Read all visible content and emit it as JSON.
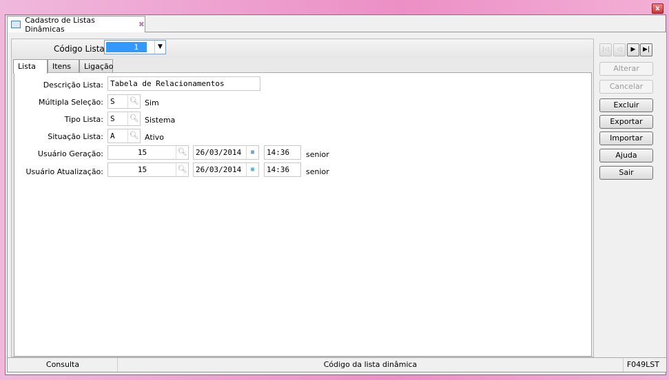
{
  "window": {
    "tab_title": "Cadastro de Listas Dinâmicas"
  },
  "header": {
    "codigo_label": "Código Lista:",
    "codigo_value": "1"
  },
  "tabs": [
    "Lista",
    "Itens",
    "Ligação"
  ],
  "form": {
    "descricao_label": "Descrição Lista:",
    "descricao_value": "Tabela de Relacionamentos",
    "multipla_label": "Múltipla Seleção:",
    "multipla_value": "S",
    "multipla_desc": "Sim",
    "tipo_label": "Tipo Lista:",
    "tipo_value": "S",
    "tipo_desc": "Sistema",
    "situacao_label": "Situação Lista:",
    "situacao_value": "A",
    "situacao_desc": "Ativo",
    "geracao_label": "Usuário Geração:",
    "geracao_user": "15",
    "geracao_date": "26/03/2014",
    "geracao_time": "14:36",
    "geracao_name": "senior",
    "atualizacao_label": "Usuário Atualização:",
    "atualizacao_user": "15",
    "atualizacao_date": "26/03/2014",
    "atualizacao_time": "14:36",
    "atualizacao_name": "senior"
  },
  "buttons": {
    "alterar": "Alterar",
    "cancelar": "Cancelar",
    "excluir": "Excluir",
    "exportar": "Exportar",
    "importar": "Importar",
    "ajuda": "Ajuda",
    "sair": "Sair"
  },
  "status": {
    "mode": "Consulta",
    "message": "Código da lista dinâmica",
    "code": "F049LST"
  }
}
